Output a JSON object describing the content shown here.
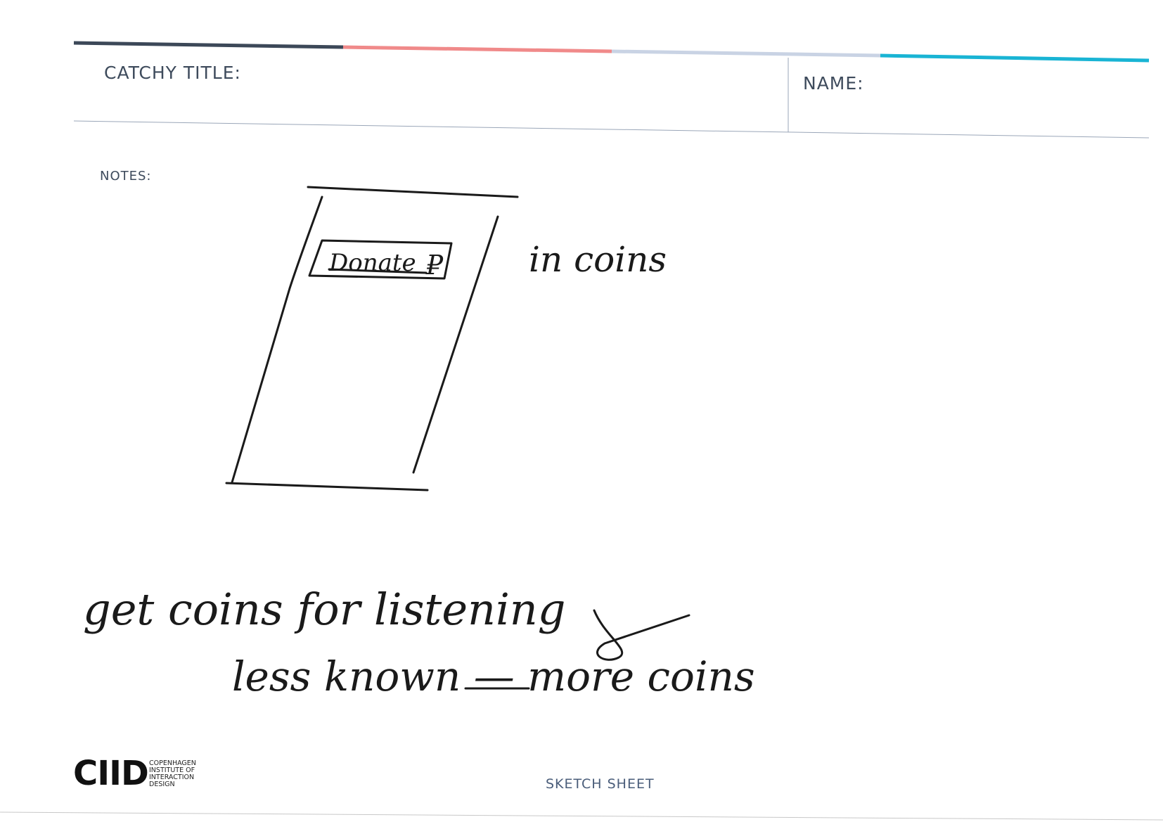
{
  "header": {
    "title_label": "CATCHY TITLE:",
    "name_label": "NAME:",
    "stripe_colors": [
      "#3c4858",
      "#f08a8a",
      "#c9d3e4",
      "#19b4d4"
    ]
  },
  "notes_label": "NOTES:",
  "sketch": {
    "button_label": "Donate",
    "button_symbol": "₽",
    "side_note": "in coins",
    "line1": "get coins for listening",
    "line2": "less known — more coins"
  },
  "footer": {
    "logo_mark": "CIID",
    "logo_lines": [
      "COPENHAGEN",
      "INSTITUTE OF",
      "INTERACTION",
      "DESIGN"
    ],
    "sheet_type": "SKETCH SHEET"
  }
}
